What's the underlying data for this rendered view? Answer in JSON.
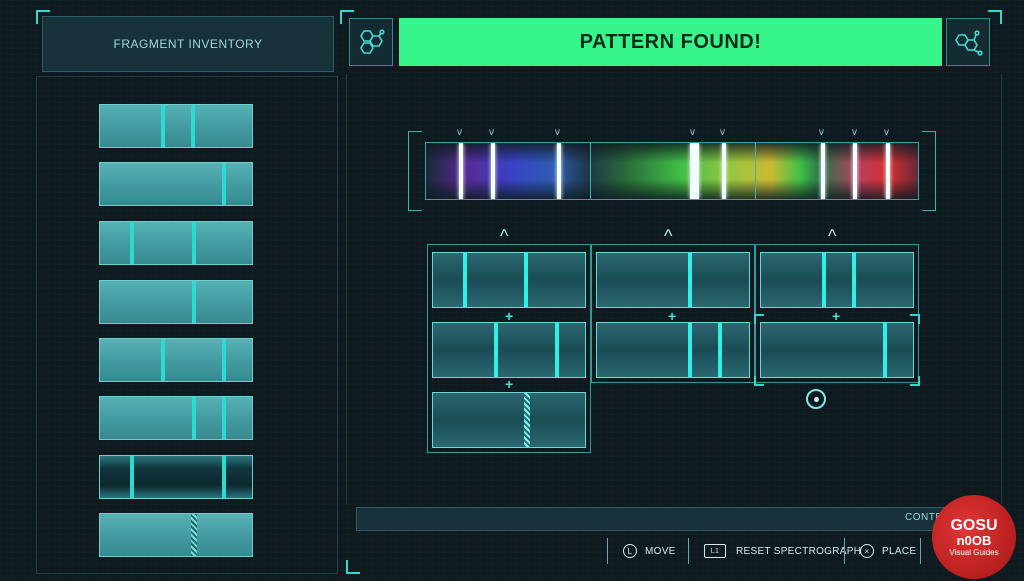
{
  "inventory": {
    "title": "FRAGMENT INVENTORY"
  },
  "status": {
    "banner": "PATTERN FOUND!"
  },
  "controls": {
    "label": "CONTR",
    "move": {
      "key": "L",
      "label": "MOVE"
    },
    "reset": {
      "key": "L1",
      "label": "RESET SPECTROGRAPH"
    },
    "place": {
      "key": "×",
      "label": "PLACE"
    }
  },
  "watermark": {
    "line1": "GOSU",
    "line2": "n0OB",
    "line3": "Visual Guides"
  },
  "icons": {
    "header": "molecule-icon",
    "cursor": "cursor-ring-icon"
  },
  "colors": {
    "accent": "#35f58b",
    "line": "#2ff0e6",
    "frame": "#2f9c9c"
  }
}
